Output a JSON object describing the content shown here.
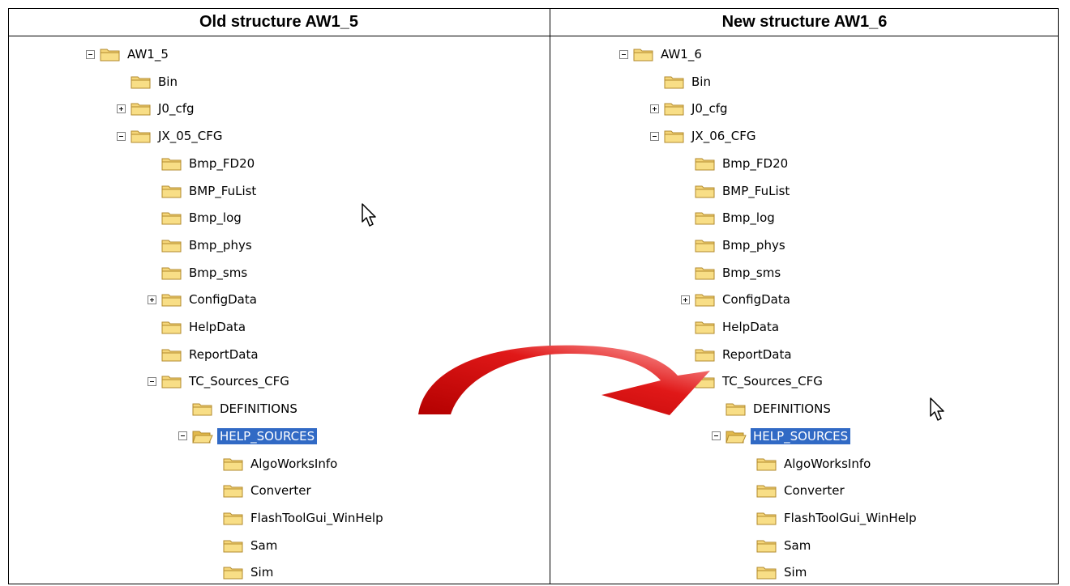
{
  "headers": {
    "left": "Old structure AW1_5",
    "right": "New structure AW1_6"
  },
  "colors": {
    "selection": "#316ac5",
    "folder": "#f5d67a",
    "arrow": "#d91414"
  },
  "left_tree": [
    {
      "label": "AW1_5",
      "depth": 0,
      "expander": "minus",
      "open": false,
      "selected": false
    },
    {
      "label": "Bin",
      "depth": 1,
      "expander": "none",
      "open": false,
      "selected": false
    },
    {
      "label": "J0_cfg",
      "depth": 1,
      "expander": "plus",
      "open": false,
      "selected": false
    },
    {
      "label": "JX_05_CFG",
      "depth": 1,
      "expander": "minus",
      "open": false,
      "selected": false
    },
    {
      "label": "Bmp_FD20",
      "depth": 2,
      "expander": "none",
      "open": false,
      "selected": false
    },
    {
      "label": "BMP_FuList",
      "depth": 2,
      "expander": "none",
      "open": false,
      "selected": false
    },
    {
      "label": "Bmp_log",
      "depth": 2,
      "expander": "none",
      "open": false,
      "selected": false
    },
    {
      "label": "Bmp_phys",
      "depth": 2,
      "expander": "none",
      "open": false,
      "selected": false
    },
    {
      "label": "Bmp_sms",
      "depth": 2,
      "expander": "none",
      "open": false,
      "selected": false
    },
    {
      "label": "ConfigData",
      "depth": 2,
      "expander": "plus",
      "open": false,
      "selected": false
    },
    {
      "label": "HelpData",
      "depth": 2,
      "expander": "none",
      "open": false,
      "selected": false
    },
    {
      "label": "ReportData",
      "depth": 2,
      "expander": "none",
      "open": false,
      "selected": false
    },
    {
      "label": "TC_Sources_CFG",
      "depth": 2,
      "expander": "minus",
      "open": false,
      "selected": false
    },
    {
      "label": "DEFINITIONS",
      "depth": 3,
      "expander": "none",
      "open": false,
      "selected": false
    },
    {
      "label": "HELP_SOURCES",
      "depth": 3,
      "expander": "minus",
      "open": true,
      "selected": true
    },
    {
      "label": "AlgoWorksInfo",
      "depth": 4,
      "expander": "none",
      "open": false,
      "selected": false
    },
    {
      "label": "Converter",
      "depth": 4,
      "expander": "none",
      "open": false,
      "selected": false
    },
    {
      "label": "FlashToolGui_WinHelp",
      "depth": 4,
      "expander": "none",
      "open": false,
      "selected": false
    },
    {
      "label": "Sam",
      "depth": 4,
      "expander": "none",
      "open": false,
      "selected": false
    },
    {
      "label": "Sim",
      "depth": 4,
      "expander": "none",
      "open": false,
      "selected": false
    }
  ],
  "right_tree": [
    {
      "label": "AW1_6",
      "depth": 0,
      "expander": "minus",
      "open": false,
      "selected": false
    },
    {
      "label": "Bin",
      "depth": 1,
      "expander": "none",
      "open": false,
      "selected": false
    },
    {
      "label": "J0_cfg",
      "depth": 1,
      "expander": "plus",
      "open": false,
      "selected": false
    },
    {
      "label": "JX_06_CFG",
      "depth": 1,
      "expander": "minus",
      "open": false,
      "selected": false
    },
    {
      "label": "Bmp_FD20",
      "depth": 2,
      "expander": "none",
      "open": false,
      "selected": false
    },
    {
      "label": "BMP_FuList",
      "depth": 2,
      "expander": "none",
      "open": false,
      "selected": false
    },
    {
      "label": "Bmp_log",
      "depth": 2,
      "expander": "none",
      "open": false,
      "selected": false
    },
    {
      "label": "Bmp_phys",
      "depth": 2,
      "expander": "none",
      "open": false,
      "selected": false
    },
    {
      "label": "Bmp_sms",
      "depth": 2,
      "expander": "none",
      "open": false,
      "selected": false
    },
    {
      "label": "ConfigData",
      "depth": 2,
      "expander": "plus",
      "open": false,
      "selected": false
    },
    {
      "label": "HelpData",
      "depth": 2,
      "expander": "none",
      "open": false,
      "selected": false
    },
    {
      "label": "ReportData",
      "depth": 2,
      "expander": "none",
      "open": false,
      "selected": false
    },
    {
      "label": "TC_Sources_CFG",
      "depth": 2,
      "expander": "minus",
      "open": false,
      "selected": false
    },
    {
      "label": "DEFINITIONS",
      "depth": 3,
      "expander": "none",
      "open": false,
      "selected": false
    },
    {
      "label": "HELP_SOURCES",
      "depth": 3,
      "expander": "minus",
      "open": true,
      "selected": true
    },
    {
      "label": "AlgoWorksInfo",
      "depth": 4,
      "expander": "none",
      "open": false,
      "selected": false
    },
    {
      "label": "Converter",
      "depth": 4,
      "expander": "none",
      "open": false,
      "selected": false
    },
    {
      "label": "FlashToolGui_WinHelp",
      "depth": 4,
      "expander": "none",
      "open": false,
      "selected": false
    },
    {
      "label": "Sam",
      "depth": 4,
      "expander": "none",
      "open": false,
      "selected": false
    },
    {
      "label": "Sim",
      "depth": 4,
      "expander": "none",
      "open": false,
      "selected": false
    }
  ],
  "icons": {
    "folder": "folder-icon",
    "open_folder": "folder-open-icon",
    "cursor": "mouse-cursor-icon",
    "arrow": "curved-arrow-icon"
  }
}
